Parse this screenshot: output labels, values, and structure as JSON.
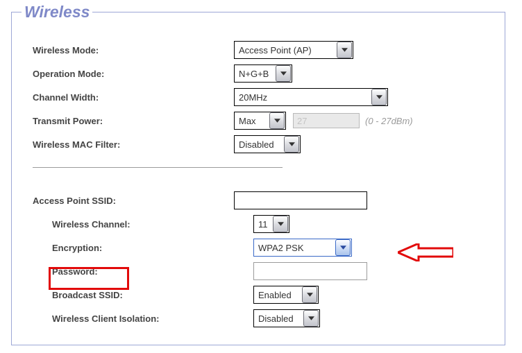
{
  "legend": "Wireless",
  "labels": {
    "wireless_mode": "Wireless Mode:",
    "operation_mode": "Operation Mode:",
    "channel_width": "Channel Width:",
    "transmit_power": "Transmit Power:",
    "mac_filter": "Wireless MAC Filter:",
    "ap_ssid": "Access Point SSID:",
    "wireless_channel": "Wireless Channel:",
    "encryption": "Encryption:",
    "password": "Password:",
    "broadcast_ssid": "Broadcast SSID:",
    "client_isolation": "Wireless Client Isolation:"
  },
  "values": {
    "wireless_mode": "Access Point (AP)",
    "operation_mode": "N+G+B",
    "channel_width": "20MHz",
    "transmit_power": "Max",
    "transmit_power_custom": "27",
    "transmit_power_hint": "(0 - 27dBm)",
    "mac_filter": "Disabled",
    "ap_ssid": "",
    "wireless_channel": "11",
    "encryption": "WPA2 PSK",
    "password": "",
    "broadcast_ssid": "Enabled",
    "client_isolation": "Disabled"
  },
  "icons": {
    "dropdown": "chevron-down"
  }
}
